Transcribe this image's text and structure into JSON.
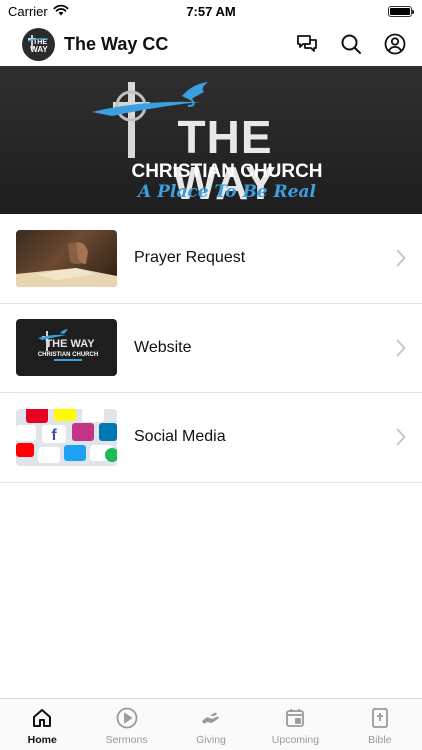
{
  "status_bar": {
    "carrier": "Carrier",
    "time": "7:57 AM",
    "battery_level": 1.0
  },
  "header": {
    "title": "The Way CC",
    "logo_icon": "church-logo-icon",
    "actions": [
      "chat-icon",
      "search-icon",
      "profile-icon"
    ]
  },
  "banner": {
    "line1": "THE WAY",
    "line2": "CHRISTIAN CHURCH",
    "line3": "A Place To Be Real",
    "accent_color": "#3aa0e0"
  },
  "list": {
    "items": [
      {
        "label": "Prayer Request",
        "thumb": "praying-hands-image"
      },
      {
        "label": "Website",
        "thumb": "the-way-logo-image"
      },
      {
        "label": "Social Media",
        "thumb": "social-media-keyboard-image"
      }
    ]
  },
  "tabs": [
    {
      "label": "Home",
      "icon": "home-icon",
      "active": true
    },
    {
      "label": "Sermons",
      "icon": "play-circle-icon",
      "active": false
    },
    {
      "label": "Giving",
      "icon": "giving-hand-icon",
      "active": false
    },
    {
      "label": "Upcoming",
      "icon": "calendar-icon",
      "active": false
    },
    {
      "label": "Bible",
      "icon": "bible-icon",
      "active": false
    }
  ],
  "colors": {
    "active_tab": "#111111",
    "inactive_tab": "#9a9a9a",
    "banner_bg": "#262626"
  }
}
